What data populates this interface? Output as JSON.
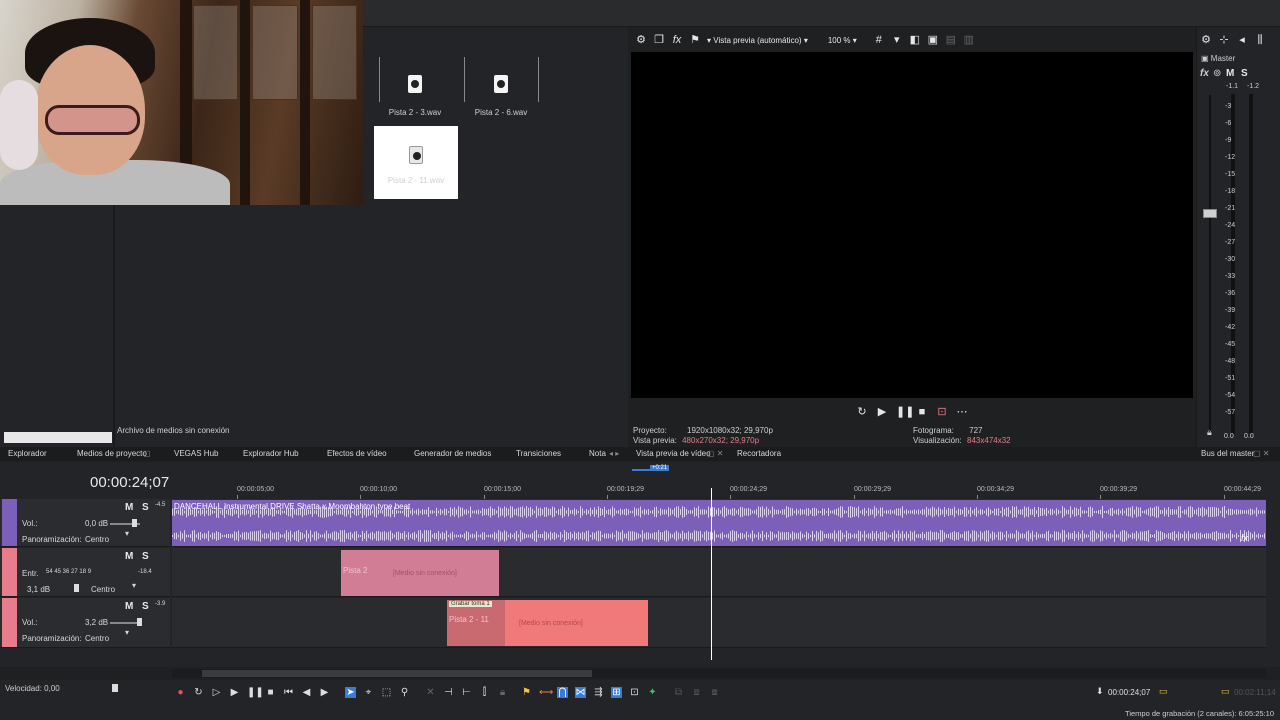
{
  "media": {
    "items": [
      {
        "label": "Pista 2 - 3.wav",
        "selected": false
      },
      {
        "label": "Pista 2 - 6.wav",
        "selected": false
      },
      {
        "label": "Pista 2 - 11.wav",
        "selected": true
      }
    ],
    "offline_note": "Archivo de medios sin conexión"
  },
  "preview": {
    "mode": "Vista previa (automático)",
    "zoom": "100 %",
    "project_label": "Proyecto:",
    "project_value": "1920x1080x32; 29,970p",
    "preview_label": "Vista previa:",
    "preview_value": "480x270x32; 29,970p",
    "frame_label": "Fotograma:",
    "frame_value": "727",
    "display_label": "Visualización:",
    "display_value": "843x474x32"
  },
  "master": {
    "title": "Master",
    "m": "M",
    "s": "S",
    "peak_l": "-1.1",
    "peak_r": "-1.2",
    "ticks": [
      "3",
      "6",
      "9",
      "12",
      "15",
      "18",
      "21",
      "24",
      "27",
      "30",
      "33",
      "36",
      "39",
      "42",
      "45",
      "48",
      "51",
      "54",
      "57"
    ],
    "bottom_l": "0.0",
    "bottom_r": "0.0"
  },
  "tabs": {
    "explorador": "Explorador",
    "medios": "Medios de proyecto",
    "hub": "VEGAS Hub",
    "explorador_hub": "Explorador Hub",
    "efectos": "Efectos de vídeo",
    "generador": "Generador de medios",
    "transiciones": "Transiciones",
    "notas": "Nota",
    "vista_previa": "Vista previa de vídeo",
    "recortadora": "Recortadora",
    "bus": "Bus del master"
  },
  "timeline": {
    "timecode": "00:00:24;07",
    "cursor_badge": "+0:21",
    "ruler": [
      "00:00:05;00",
      "00:00:10;00",
      "00:00:15;00",
      "00:00:19;29",
      "00:00:24;29",
      "00:00:29;29",
      "00:00:34;29",
      "00:00:39;29",
      "00:00:44;29"
    ],
    "tracks": [
      {
        "m": "M",
        "s": "S",
        "vol_label": "Vol.:",
        "vol_value": "0,0 dB",
        "pan_label": "Panoramización:",
        "pan_value": "Centro",
        "meter_top": "-4.5"
      },
      {
        "m": "M",
        "s": "S",
        "input_label": "Entr.",
        "input_ticks": "54 45 36 27 18 9",
        "input_value": "-18.4",
        "vol_value": "3,1 dB",
        "pan_value": "Centro"
      },
      {
        "m": "M",
        "s": "S",
        "vol_label": "Vol.:",
        "vol_value": "3,2 dB",
        "pan_label": "Panoramización:",
        "pan_value": "Centro",
        "meter_top": "-3.9"
      }
    ],
    "events": {
      "main_title": "DANCEHALL Instrumental  DRIVE Shatta x Moombahton type beat",
      "pista2_short": "Pista 2",
      "offline": "[Medio sin conexión]",
      "grabar": "Grabar toma 1",
      "pista2_11": "Pista 2 - 11"
    }
  },
  "bottom": {
    "speed": "Velocidad: 0,00",
    "time": "00:00:24;07",
    "faded_time": "00:02:11;14",
    "status": "Tiempo de grabación (2 canales): 6:05:25:10"
  },
  "colors": {
    "track_purple": "#7b5fb8",
    "track_pink": "#e87c8c",
    "event_salmon": "#f07a7a",
    "accent_blue": "#3a7bd5"
  }
}
